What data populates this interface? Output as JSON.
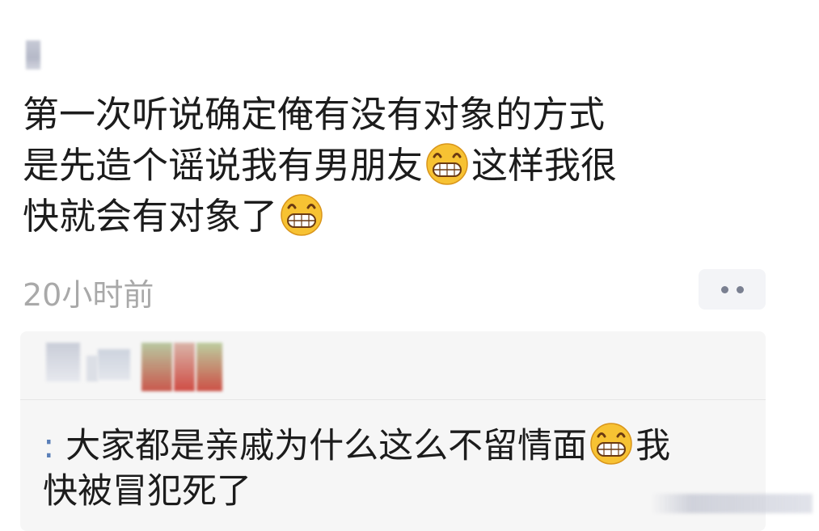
{
  "post": {
    "line1": "第一次听说确定俺有没有对象的方式",
    "line2_a": "是先造个谣说我有男朋友",
    "line2_b": "这样我很",
    "line3_a": "快就会有对象了",
    "emoji": "grin-emoji",
    "timestamp": "20小时前"
  },
  "more": {
    "icon": "more-dots-icon"
  },
  "reply": {
    "prefix": ":",
    "line1_a": "大家都是亲戚为什么这么不留情面",
    "line1_b": "我",
    "line2": "快被冒犯死了"
  }
}
